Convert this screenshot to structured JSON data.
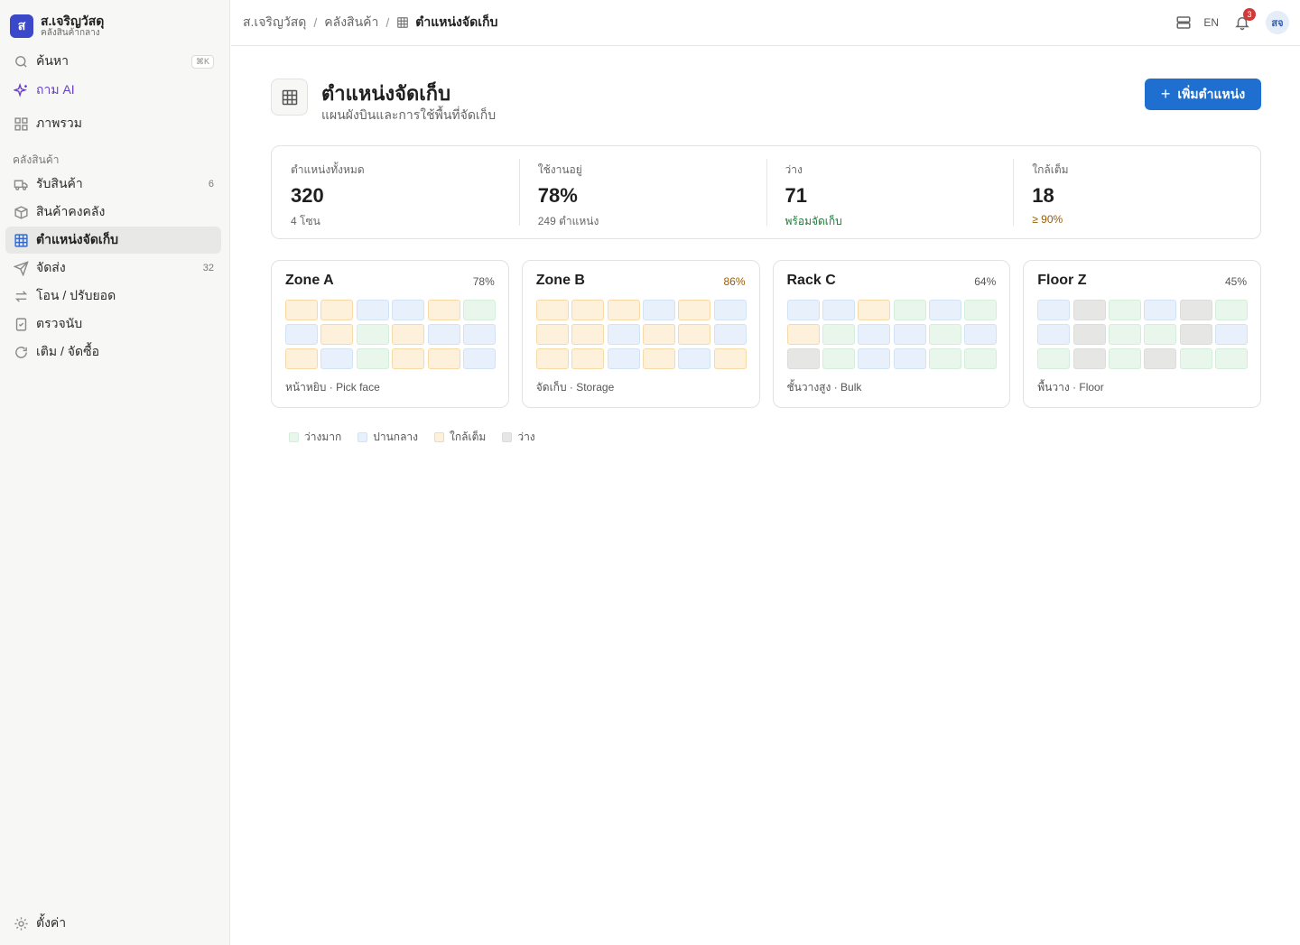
{
  "brand": {
    "logo_letter": "ส",
    "name": "ส.เจริญวัสดุ",
    "subtitle": "คลังสินค้ากลาง"
  },
  "sidebar": {
    "search": {
      "label": "ค้นหา",
      "shortcut": "⌘K",
      "icon": "search-icon"
    },
    "ask_ai": {
      "label": "ถาม AI",
      "icon": "sparkle-icon"
    },
    "overview": {
      "label": "ภาพรวม",
      "icon": "grid-icon"
    },
    "section_label": "คลังสินค้า",
    "items": [
      {
        "label": "รับสินค้า",
        "count": "6",
        "icon": "truck-icon"
      },
      {
        "label": "สินค้าคงคลัง",
        "count": "",
        "icon": "box-icon"
      },
      {
        "label": "ตำแหน่งจัดเก็บ",
        "count": "",
        "icon": "table-grid-icon",
        "active": true
      },
      {
        "label": "จัดส่ง",
        "count": "32",
        "icon": "send-icon"
      },
      {
        "label": "โอน / ปรับยอด",
        "count": "",
        "icon": "transfer-icon"
      },
      {
        "label": "ตรวจนับ",
        "count": "",
        "icon": "checklist-icon"
      },
      {
        "label": "เติม / จัดซื้อ",
        "count": "",
        "icon": "refresh-icon"
      }
    ],
    "settings": {
      "label": "ตั้งค่า",
      "icon": "gear-icon"
    }
  },
  "topbar": {
    "breadcrumb": [
      "ส.เจริญวัสดุ",
      "คลังสินค้า",
      "ตำแหน่งจัดเก็บ"
    ],
    "lang": "EN",
    "notifications": "3",
    "avatar": "สจ"
  },
  "page": {
    "title": "ตำแหน่งจัดเก็บ",
    "subtitle": "แผนผังบินและการใช้พื้นที่จัดเก็บ",
    "add_button": "เพิ่มตำแหน่ง"
  },
  "stats": [
    {
      "label": "ตำแหน่งทั้งหมด",
      "value": "320",
      "note": "4 โซน",
      "tone": ""
    },
    {
      "label": "ใช้งานอยู่",
      "value": "78%",
      "note": "249 ตำแหน่ง",
      "tone": ""
    },
    {
      "label": "ว่าง",
      "value": "71",
      "note": "พร้อมจัดเก็บ",
      "tone": "green"
    },
    {
      "label": "ใกล้เต็ม",
      "value": "18",
      "note": "≥ 90%",
      "tone": "amber"
    }
  ],
  "zones": [
    {
      "name": "Zone A",
      "pct": "78%",
      "high": false,
      "caption": "หน้าหยิบ · Pick face",
      "cells": [
        "near",
        "near",
        "mid",
        "mid",
        "near",
        "free",
        "mid",
        "near",
        "free",
        "near",
        "mid",
        "mid",
        "near",
        "mid",
        "free",
        "near",
        "near",
        "mid"
      ]
    },
    {
      "name": "Zone B",
      "pct": "86%",
      "high": true,
      "caption": "จัดเก็บ · Storage",
      "cells": [
        "near",
        "near",
        "near",
        "mid",
        "near",
        "mid",
        "near",
        "near",
        "mid",
        "near",
        "near",
        "mid",
        "near",
        "near",
        "mid",
        "near",
        "mid",
        "near"
      ]
    },
    {
      "name": "Rack C",
      "pct": "64%",
      "high": false,
      "caption": "ชั้นวางสูง · Bulk",
      "cells": [
        "mid",
        "mid",
        "near",
        "free",
        "mid",
        "free",
        "near",
        "free",
        "mid",
        "mid",
        "free",
        "mid",
        "empty",
        "free",
        "mid",
        "mid",
        "free",
        "free"
      ]
    },
    {
      "name": "Floor Z",
      "pct": "45%",
      "high": false,
      "caption": "พื้นวาง · Floor",
      "cells": [
        "mid",
        "empty",
        "free",
        "mid",
        "empty",
        "free",
        "mid",
        "empty",
        "free",
        "free",
        "empty",
        "mid",
        "free",
        "empty",
        "free",
        "empty",
        "free",
        "free"
      ]
    }
  ],
  "legend": [
    {
      "label": "ว่างมาก",
      "tone": "free"
    },
    {
      "label": "ปานกลาง",
      "tone": "mid"
    },
    {
      "label": "ใกล้เต็ม",
      "tone": "near"
    },
    {
      "label": "ว่าง",
      "tone": "empty"
    }
  ],
  "colors": {
    "accent": "#1f6fd1",
    "brand": "#3b48c9",
    "free": "#e8f6ec",
    "mid": "#e7f0fb",
    "near": "#fdf1dc",
    "empty": "#e6e6e5"
  }
}
